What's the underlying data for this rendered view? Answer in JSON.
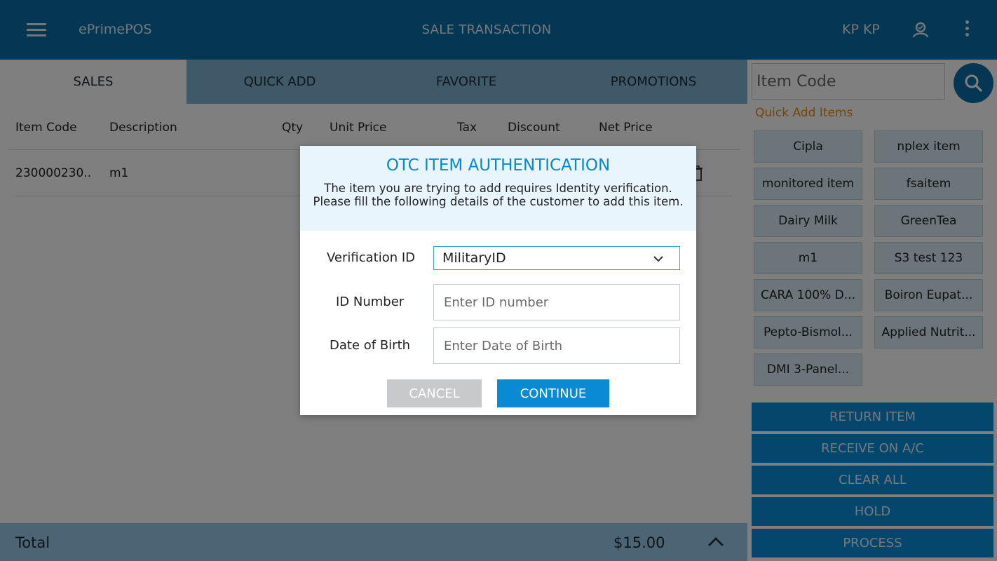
{
  "topbar": {
    "app_name": "ePrimePOS",
    "title": "SALE TRANSACTION",
    "user_name": "KP KP"
  },
  "tabs": [
    {
      "label": "SALES",
      "active": true
    },
    {
      "label": "QUICK ADD",
      "active": false
    },
    {
      "label": "FAVORITE",
      "active": false
    },
    {
      "label": "PROMOTIONS",
      "active": false
    }
  ],
  "table": {
    "headers": [
      "Item Code",
      "Description",
      "Qty",
      "Unit Price",
      "Tax",
      "Discount",
      "Net Price"
    ],
    "rows": [
      {
        "item_code": "230000230..",
        "description": "m1"
      }
    ]
  },
  "footer": {
    "total_label": "Total",
    "total_value": "$15.00"
  },
  "right_panel": {
    "item_code_placeholder": "Item Code",
    "quick_add_title": "Quick Add Items",
    "quick_add_items": [
      "Cipla",
      "nplex item",
      "monitored item",
      "fsaitem",
      "Dairy Milk",
      "GreenTea",
      "m1",
      "S3 test 123",
      "CARA 100% D...",
      "Boiron Eupat...",
      "Pepto-Bismol...",
      "Applied Nutrit...",
      "DMI 3-Panel..."
    ],
    "actions": [
      "RETURN ITEM",
      "RECEIVE ON A/C",
      "CLEAR ALL",
      "HOLD",
      "PROCESS"
    ]
  },
  "modal": {
    "title": "OTC ITEM AUTHENTICATION",
    "message": "The item you are trying to add requires Identity verification. Please fill the following details of the customer to add this item.",
    "verification_label": "Verification ID",
    "verification_value": "MilitaryID",
    "id_number_label": "ID Number",
    "id_number_placeholder": "Enter ID number",
    "dob_label": "Date of Birth",
    "dob_placeholder": "Enter Date of Birth",
    "cancel_label": "CANCEL",
    "continue_label": "CONTINUE"
  },
  "colors": {
    "primary": "#0a6fa8",
    "accent": "#0a8ad3",
    "quick_add_title": "#e88a1a"
  }
}
